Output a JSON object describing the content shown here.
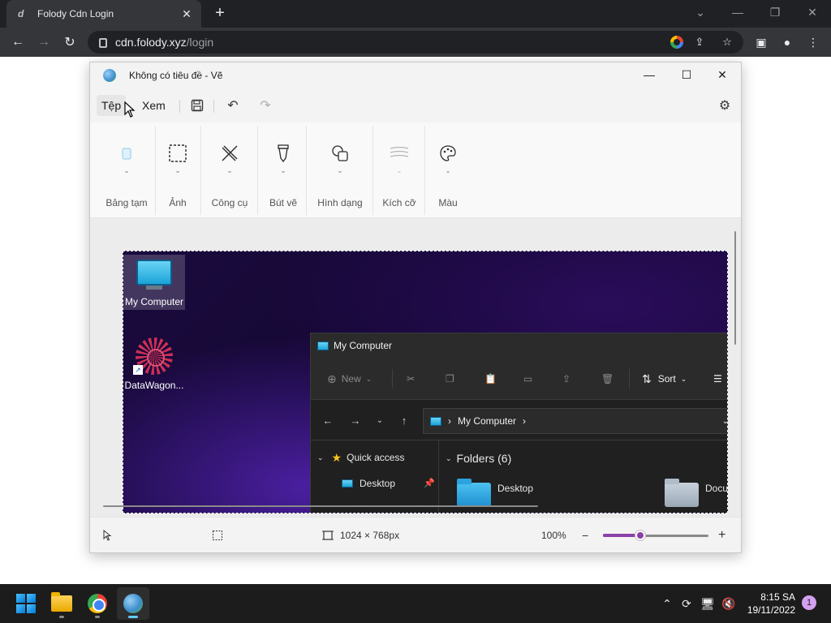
{
  "browser": {
    "tab_title": "Folody Cdn Login",
    "url_host": "cdn.folody.xyz",
    "url_path": "/login"
  },
  "paint": {
    "window_title": "Không có tiêu đề - Vẽ",
    "menu": {
      "file": "Tệp",
      "view": "Xem"
    },
    "ribbon": [
      {
        "label": "Bảng tạm",
        "icon": "clipboard-icon"
      },
      {
        "label": "Ảnh",
        "icon": "select-image-icon"
      },
      {
        "label": "Công cụ",
        "icon": "tools-icon"
      },
      {
        "label": "Bút vẽ",
        "icon": "brush-icon"
      },
      {
        "label": "Hình dạng",
        "icon": "shapes-icon"
      },
      {
        "label": "Kích cỡ",
        "icon": "size-icon"
      },
      {
        "label": "Màu",
        "icon": "palette-icon"
      }
    ],
    "status": {
      "canvas_size": "1024 × 768px",
      "zoom": "100%",
      "zoom_level": 0.35
    }
  },
  "desktop": {
    "icons": [
      {
        "label": "My Computer"
      },
      {
        "label": "DataWagon..."
      }
    ]
  },
  "explorer": {
    "title": "My Computer",
    "new_label": "New",
    "sort_label": "Sort",
    "address": "My Computer",
    "quick_access": "Quick access",
    "desktop_nav": "Desktop",
    "folders_heading": "Folders (6)",
    "folders": [
      {
        "name": "Desktop"
      },
      {
        "name": "Docu"
      }
    ]
  },
  "taskbar": {
    "time": "8:15 SA",
    "date": "19/11/2022",
    "notification_count": "1"
  }
}
